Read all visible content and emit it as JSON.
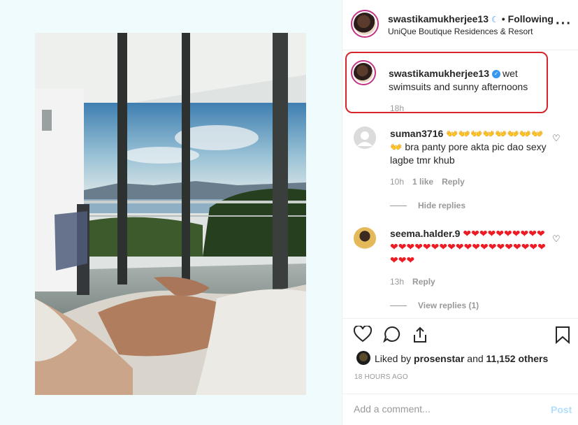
{
  "header": {
    "username": "swastikamukherjee13",
    "moon_icon": "crescent-moon-icon",
    "separator": "•",
    "follow_status": "Following",
    "location": "UniQue Boutique Residences & Resort",
    "more_icon": "more-options-icon"
  },
  "caption": {
    "username": "swastikamukherjee13",
    "verified_icon": "verified-badge-icon",
    "text": "wet swimsuits and sunny afternoons",
    "time": "18h"
  },
  "comments": [
    {
      "username": "suman3716",
      "emoji": "👐👐👐👐👐👐👐👐👐",
      "text": "bra panty pore akta pic dao sexy lagbe tmr khub",
      "time": "10h",
      "likes": "1 like",
      "reply": "Reply",
      "replies_toggle": "Hide replies"
    },
    {
      "username": "seema.halder.9",
      "hearts": "❤❤❤❤❤❤❤❤❤❤❤❤❤❤❤❤❤❤❤❤❤❤❤❤❤❤❤❤❤❤❤❤",
      "time": "13h",
      "reply": "Reply",
      "replies_toggle": "View replies (1)"
    }
  ],
  "actions": {
    "like_icon": "heart-icon",
    "comment_icon": "comment-icon",
    "share_icon": "share-icon",
    "save_icon": "bookmark-icon"
  },
  "likes": {
    "prefix": "Liked by",
    "user": "prosenstar",
    "and": "and",
    "others": "11,152 others"
  },
  "timestamp": "18 HOURS AGO",
  "comment_box": {
    "placeholder": "Add a comment...",
    "post_label": "Post"
  },
  "colors": {
    "highlight_border": "#d6252b",
    "verified": "#3897f0",
    "post_disabled": "#b2dffc",
    "hearts": "#ed1c24"
  }
}
